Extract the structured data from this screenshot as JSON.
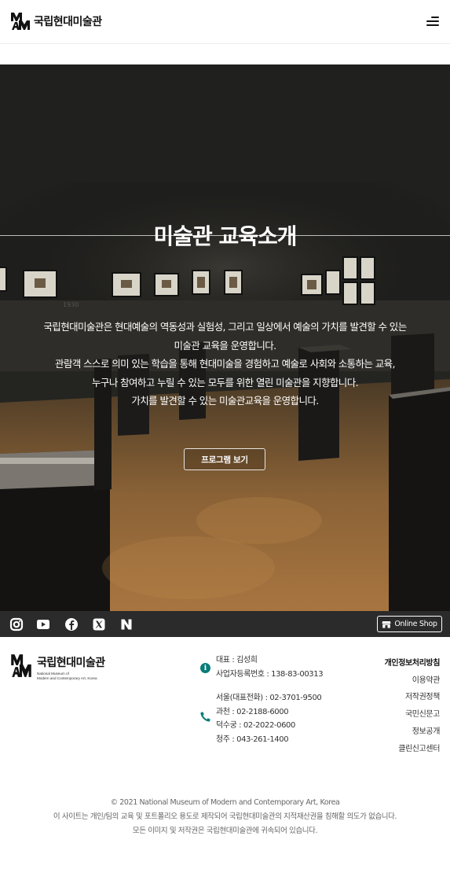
{
  "header": {
    "logo_text": "국립현대미술관",
    "logo_mark": "MMCA",
    "menu_icon": "hamburger-menu-icon"
  },
  "hero": {
    "title": "미술관 교육소개",
    "description": [
      "국립현대미술관은 현대예술의 역동성과 실험성, 그리고 일상에서 예술의 가치를 발견할 수 있는",
      "미술관 교육을 운영합니다.",
      "관람객 스스로 의미 있는 학습을 통해 현대미술을 경험하고 예술로 사회와 소통하는 교육,",
      "누구나 참여하고 누릴 수 있는 모두를 위한 열린 미술관을 지향합니다.",
      "가치를 발견할 수 있는 미술관교육을 운영합니다."
    ],
    "button_label": "프로그램 보기"
  },
  "social": {
    "icons": [
      "instagram-icon",
      "youtube-icon",
      "facebook-icon",
      "x-icon",
      "naver-icon"
    ],
    "shop_label": "Online Shop"
  },
  "footer": {
    "logo_text": "국립현대미술관",
    "logo_sub": [
      "National Museum of",
      "Modern and Contemporary Art, Korea"
    ],
    "rep": "대표 : 김성희",
    "biz_no": "사업자등록번호 : 138-83-00313",
    "phones": [
      "서울(대표전화) : 02-3701-9500",
      "과천 : 02-2188-6000",
      "덕수궁 : 02-2022-0600",
      "청주 : 043-261-1400"
    ],
    "links": [
      "개인정보처리방침",
      "이용약관",
      "저작권정책",
      "국민신문고",
      "정보공개",
      "클린신고센터"
    ],
    "copyright": [
      "© 2021 National Museum of Modern and Contemporary Art, Korea",
      "이 사이트는 개인/팀의 교육 및 포트폴리오 용도로 제작되어 국립현대미술관의 지적재산권을 침해할 의도가 없습니다.",
      "모든 이미지 및 저작권은 국립현대미술관에 귀속되어 있습니다."
    ]
  },
  "colors": {
    "hero_dark": "#1f1f1d",
    "social_bar": "#2b2b2b",
    "info_icon": "#0a7d7a"
  }
}
